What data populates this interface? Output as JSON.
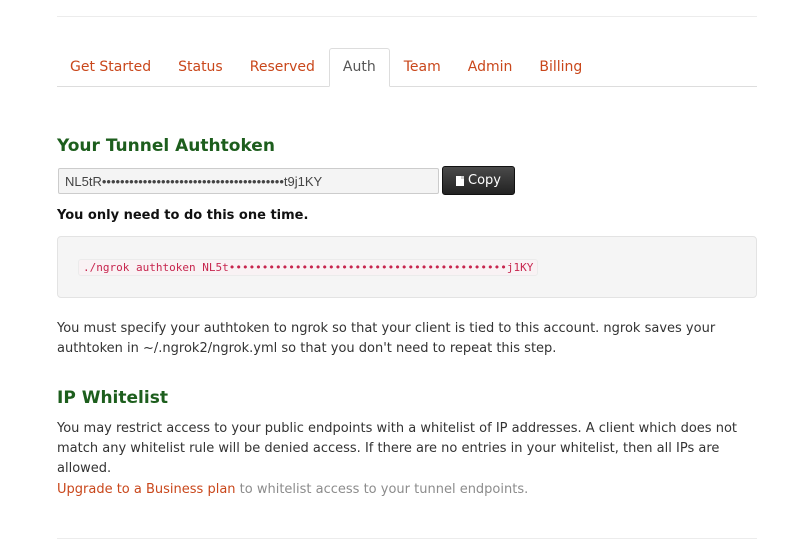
{
  "tabs": [
    "Get Started",
    "Status",
    "Reserved",
    "Auth",
    "Team",
    "Admin",
    "Billing"
  ],
  "active_tab": "Auth",
  "authtoken": {
    "title": "Your Tunnel Authtoken",
    "token_value": "NL5tR••••••••••••••••••••••••••••••••••••••••t9j1KY",
    "copy_label": "Copy",
    "copy_icon": "file-icon",
    "one_time_note": "You only need to do this one time.",
    "command": "./ngrok authtoken NL5t••••••••••••••••••••••••••••••••••••••••••j1KY",
    "description": "You must specify your authtoken to ngrok so that your client is tied to this account. ngrok saves your authtoken in ~/.ngrok2/ngrok.yml so that you don't need to repeat this step."
  },
  "whitelist": {
    "title": "IP Whitelist",
    "description": "You may restrict access to your public endpoints with a whitelist of IP addresses. A client which does not match any whitelist rule will be denied access. If there are no entries in your whitelist, then all IPs are allowed.",
    "upgrade_link": "Upgrade to a Business plan",
    "upgrade_suffix": " to whitelist access to your tunnel endpoints."
  },
  "colors": {
    "link": "#c9471b",
    "heading": "#1d5e1d",
    "code": "#c7254e"
  }
}
